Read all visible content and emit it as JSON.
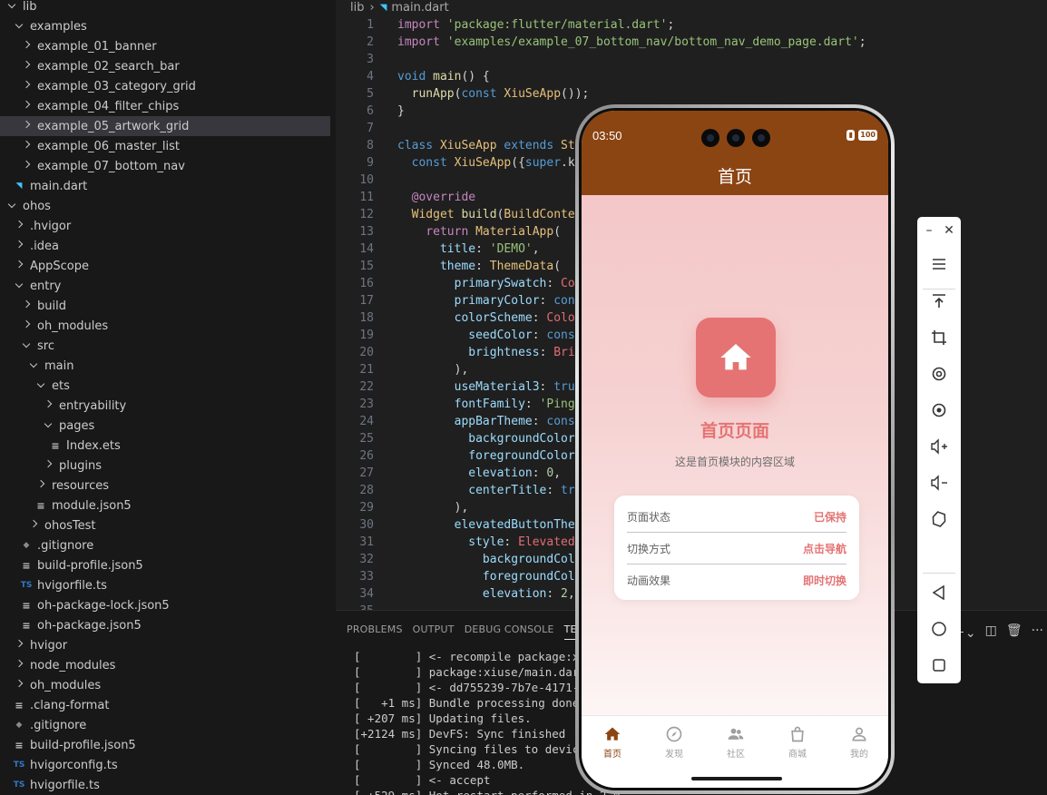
{
  "explorer": {
    "items": [
      {
        "label": "lib",
        "type": "folder-open",
        "depth": 0
      },
      {
        "label": "examples",
        "type": "folder-open",
        "depth": 1
      },
      {
        "label": "example_01_banner",
        "type": "folder",
        "depth": 2
      },
      {
        "label": "example_02_search_bar",
        "type": "folder",
        "depth": 2
      },
      {
        "label": "example_03_category_grid",
        "type": "folder",
        "depth": 2
      },
      {
        "label": "example_04_filter_chips",
        "type": "folder",
        "depth": 2
      },
      {
        "label": "example_05_artwork_grid",
        "type": "folder",
        "depth": 2,
        "selected": true
      },
      {
        "label": "example_06_master_list",
        "type": "folder",
        "depth": 2
      },
      {
        "label": "example_07_bottom_nav",
        "type": "folder",
        "depth": 2
      },
      {
        "label": "main.dart",
        "type": "dart",
        "depth": 1
      },
      {
        "label": "ohos",
        "type": "folder-open",
        "depth": 0
      },
      {
        "label": ".hvigor",
        "type": "folder",
        "depth": 1
      },
      {
        "label": ".idea",
        "type": "folder",
        "depth": 1
      },
      {
        "label": "AppScope",
        "type": "folder",
        "depth": 1
      },
      {
        "label": "entry",
        "type": "folder-open",
        "depth": 1
      },
      {
        "label": "build",
        "type": "folder",
        "depth": 2
      },
      {
        "label": "oh_modules",
        "type": "folder",
        "depth": 2
      },
      {
        "label": "src",
        "type": "folder-open",
        "depth": 2
      },
      {
        "label": "main",
        "type": "folder-open",
        "depth": 3
      },
      {
        "label": "ets",
        "type": "folder-open",
        "depth": 4
      },
      {
        "label": "entryability",
        "type": "folder",
        "depth": 5
      },
      {
        "label": "pages",
        "type": "folder-open",
        "depth": 5
      },
      {
        "label": "Index.ets",
        "type": "lines",
        "depth": 6
      },
      {
        "label": "plugins",
        "type": "folder",
        "depth": 5
      },
      {
        "label": "resources",
        "type": "folder",
        "depth": 4
      },
      {
        "label": "module.json5",
        "type": "lines",
        "depth": 4
      },
      {
        "label": "ohosTest",
        "type": "folder",
        "depth": 3
      },
      {
        "label": ".gitignore",
        "type": "git",
        "depth": 2
      },
      {
        "label": "build-profile.json5",
        "type": "lines",
        "depth": 2
      },
      {
        "label": "hvigorfile.ts",
        "type": "ts",
        "depth": 2
      },
      {
        "label": "oh-package-lock.json5",
        "type": "lines",
        "depth": 2
      },
      {
        "label": "oh-package.json5",
        "type": "lines",
        "depth": 2
      },
      {
        "label": "hvigor",
        "type": "folder",
        "depth": 1
      },
      {
        "label": "node_modules",
        "type": "folder",
        "depth": 1
      },
      {
        "label": "oh_modules",
        "type": "folder",
        "depth": 1
      },
      {
        "label": ".clang-format",
        "type": "lines",
        "depth": 1
      },
      {
        "label": ".gitignore",
        "type": "git",
        "depth": 1
      },
      {
        "label": "build-profile.json5",
        "type": "lines",
        "depth": 1
      },
      {
        "label": "hvigorconfig.ts",
        "type": "ts",
        "depth": 1
      },
      {
        "label": "hvigorfile.ts",
        "type": "ts",
        "depth": 1
      }
    ]
  },
  "editor": {
    "breadcrumb": {
      "folder": "lib",
      "file": "main.dart"
    },
    "lines": [
      {
        "n": "1",
        "html": "<span class='kw'>import</span> <span class='str'>'package:flutter/material.dart'</span>;"
      },
      {
        "n": "2",
        "html": "<span class='kw'>import</span> <span class='str'>'examples/example_07_bottom_nav/bottom_nav_demo_page.dart'</span>;"
      },
      {
        "n": "3",
        "html": ""
      },
      {
        "n": "4",
        "html": "<span class='kb'>void</span> <span class='fn'>main</span>() {"
      },
      {
        "n": "5",
        "html": "  <span class='fn'>runApp</span>(<span class='kb'>const</span> <span class='cls'>XiuSeApp</span>());"
      },
      {
        "n": "6",
        "html": "}"
      },
      {
        "n": "7",
        "html": ""
      },
      {
        "n": "8",
        "html": "<span class='kb'>class</span> <span class='cls'>XiuSeApp</span> <span class='kb'>extends</span> <span class='cls'>Sta</span>"
      },
      {
        "n": "9",
        "html": "  <span class='kb'>const</span> <span class='cls'>XiuSeApp</span>({<span class='kb'>super</span>.ke"
      },
      {
        "n": "10",
        "html": ""
      },
      {
        "n": "11",
        "html": "  <span class='ann'>@override</span>"
      },
      {
        "n": "12",
        "html": "  <span class='cls'>Widget</span> <span class='fn'>build</span>(<span class='cls'>BuildContex</span>"
      },
      {
        "n": "13",
        "html": "    <span class='kw'>return</span> <span class='cls'>MaterialApp</span>("
      },
      {
        "n": "14",
        "html": "      <span class='prop'>title</span>: <span class='str'>'DEMO'</span>,"
      },
      {
        "n": "15",
        "html": "      <span class='prop'>theme</span>: <span class='cls'>ThemeData</span>("
      },
      {
        "n": "16",
        "html": "        <span class='prop'>primarySwatch</span>: <span class='red'>Co</span>"
      },
      {
        "n": "17",
        "html": "        <span class='prop'>primaryColor</span>: <span class='kb'>cons</span>"
      },
      {
        "n": "18",
        "html": "        <span class='prop'>colorScheme</span>: <span class='red'>Color</span>"
      },
      {
        "n": "19",
        "html": "          <span class='prop'>seedColor</span>: <span class='kb'>const</span>"
      },
      {
        "n": "20",
        "html": "          <span class='prop'>brightness</span>: <span class='red'>Brig</span>"
      },
      {
        "n": "21",
        "html": "        ),"
      },
      {
        "n": "22",
        "html": "        <span class='prop'>useMaterial3</span>: <span class='kb'>true</span>"
      },
      {
        "n": "23",
        "html": "        <span class='prop'>fontFamily</span>: <span class='str'>'PingF</span>"
      },
      {
        "n": "24",
        "html": "        <span class='prop'>appBarTheme</span>: <span class='kb'>const</span>"
      },
      {
        "n": "25",
        "html": "          <span class='prop'>backgroundColor</span>"
      },
      {
        "n": "26",
        "html": "          <span class='prop'>foregroundColor</span>"
      },
      {
        "n": "27",
        "html": "          <span class='prop'>elevation</span>: <span class='num'>0</span>,"
      },
      {
        "n": "28",
        "html": "          <span class='prop'>centerTitle</span>: <span class='kb'>tru</span>"
      },
      {
        "n": "29",
        "html": "        ),"
      },
      {
        "n": "30",
        "html": "        <span class='prop'>elevatedButtonThem</span>"
      },
      {
        "n": "31",
        "html": "          <span class='prop'>style</span>: <span class='red'>ElevatedB</span>"
      },
      {
        "n": "32",
        "html": "            <span class='prop'>backgroundColo</span>"
      },
      {
        "n": "33",
        "html": "            <span class='prop'>foregroundColo</span>"
      },
      {
        "n": "34",
        "html": "            <span class='prop'>elevation</span>: <span class='num'>2</span>,"
      },
      {
        "n": "35",
        "html": ""
      }
    ]
  },
  "panel": {
    "tabs": [
      "PROBLEMS",
      "OUTPUT",
      "DEBUG CONSOLE",
      "TERMIN"
    ],
    "active_tab": 3,
    "terminal": [
      "[        ] <- recompile package:xiu",
      "[        ] package:xiuse/main.dart",
      "[        ] <- dd755239-7b7e-4171-8f",
      "[   +1 ms] Bundle processing done.",
      "[ +207 ms] Updating files.",
      "[+2124 ms] DevFS: Sync finished",
      "[        ] Syncing files to device",
      "[        ] Synced 48.0MB.",
      "[        ] <- accept",
      "[ +529 ms] Hot restart performed in 2.0"
    ]
  },
  "phone": {
    "status": {
      "time": "03:50",
      "battery": "100"
    },
    "appbar_title": "首页",
    "heading": "首页页面",
    "description": "这是首页模块的内容区域",
    "info_rows": [
      {
        "key": "页面状态",
        "value": "已保持"
      },
      {
        "key": "切换方式",
        "value": "点击导航"
      },
      {
        "key": "动画效果",
        "value": "即时切换"
      }
    ],
    "nav": [
      {
        "label": "首页",
        "icon": "home-icon",
        "active": true
      },
      {
        "label": "发现",
        "icon": "compass-icon"
      },
      {
        "label": "社区",
        "icon": "people-icon"
      },
      {
        "label": "商城",
        "icon": "shopping-bag-icon"
      },
      {
        "label": "我的",
        "icon": "person-icon"
      }
    ],
    "colors": {
      "appbar": "#8b4513",
      "accent": "#e57373"
    }
  },
  "emulator_toolbar": {
    "buttons": [
      "menu-icon",
      "upload-icon",
      "crop-icon",
      "rotate-icon",
      "location-icon",
      "volume-up-icon",
      "volume-down-icon",
      "gesture-icon",
      "back-icon",
      "home-circle-icon",
      "recents-icon"
    ]
  }
}
